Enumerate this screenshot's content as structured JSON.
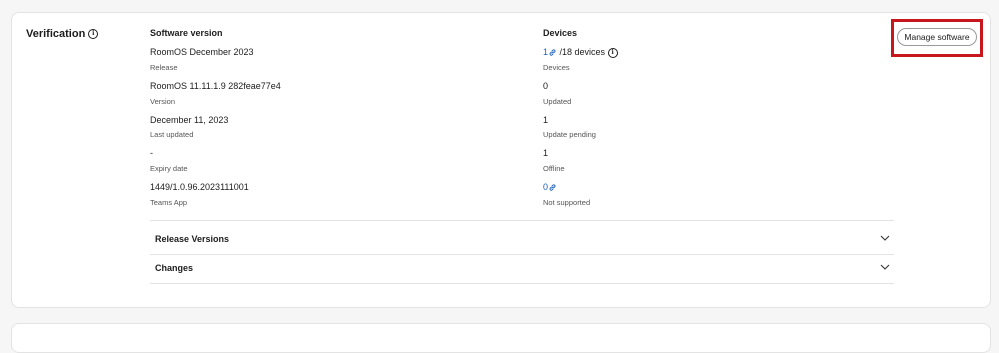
{
  "section": {
    "title": "Verification"
  },
  "software": {
    "heading": "Software version",
    "fields": [
      {
        "value": "RoomOS December 2023",
        "label": "Release"
      },
      {
        "value": "RoomOS 11.11.1.9 282feae77e4",
        "label": "Version"
      },
      {
        "value": "December 11, 2023",
        "label": "Last updated"
      },
      {
        "value": "-",
        "label": "Expiry date"
      },
      {
        "value": "1449/1.0.96.2023111001",
        "label": "Teams App"
      }
    ]
  },
  "devices": {
    "heading": "Devices",
    "total_link": "1",
    "total_suffix": "/18 devices",
    "total_label": "Devices",
    "updated_value": "0",
    "updated_label": "Updated",
    "pending_value": "1",
    "pending_label": "Update pending",
    "offline_value": "1",
    "offline_label": "Offline",
    "unsupported_link": "0",
    "unsupported_label": "Not supported"
  },
  "actions": {
    "manage_label": "Manage software"
  },
  "accordions": [
    {
      "label": "Release Versions"
    },
    {
      "label": "Changes"
    }
  ],
  "colors": {
    "link": "#1b5fbf",
    "highlight": "#c8161d"
  },
  "icons": {
    "info": "info-circle-icon",
    "link": "link-chain-icon",
    "chevron": "chevron-down-icon"
  }
}
